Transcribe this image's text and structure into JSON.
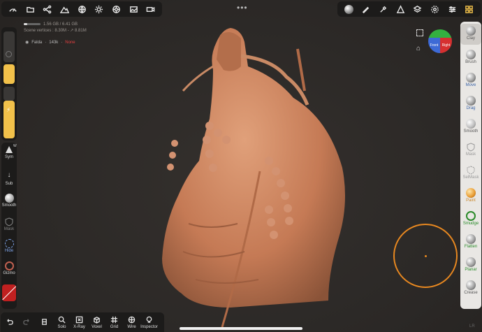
{
  "top_left_tools": [
    "dashboard-icon",
    "folder-icon",
    "scene-graph-icon",
    "mountain-icon",
    "globe-icon",
    "sun-icon",
    "gear-wheel-icon",
    "image-icon",
    "video-icon"
  ],
  "top_right_tools": [
    "matcap-icon",
    "brush-pen-icon",
    "eyedropper-icon",
    "triangle-icon",
    "layers-icon",
    "settings-icon",
    "sliders-icon",
    "grid-icon"
  ],
  "info": {
    "memory": "1.56 GB / 6.41 GB",
    "scene_vertices": "Scene vertices : 8.30M - ↗ 8.81M",
    "object_name": "Falda",
    "object_count": "143k",
    "object_tag": "None"
  },
  "left": {
    "sym_label": "Sym",
    "sym_flag": "W",
    "sub_label": "Sub",
    "smooth_label": "Smooth",
    "mask_label": "Mask",
    "hide_label": "Hide",
    "gizmo_label": "Gizmo"
  },
  "right": {
    "tools": [
      {
        "label": "Clay",
        "selected": true
      },
      {
        "label": "Brush"
      },
      {
        "label": "Move"
      },
      {
        "label": "Drag"
      },
      {
        "label": "Smooth"
      },
      {
        "label": "Mask"
      },
      {
        "label": "SelMask"
      },
      {
        "label": "Paint"
      },
      {
        "label": "Smudge"
      },
      {
        "label": "Flatten"
      },
      {
        "label": "Planar"
      },
      {
        "label": "Crease"
      }
    ]
  },
  "cube": {
    "front": "Front",
    "right": "Right"
  },
  "bottom": {
    "undo": "",
    "redo": "",
    "clip": "",
    "solo": "Solo",
    "xray": "X-Ray",
    "voxel": "Voxel",
    "grid": "Grid",
    "wire": "Wire",
    "inspector": "Inspector"
  },
  "corner_label": "LR",
  "colors": {
    "accent_yellow": "#f2c14a",
    "clay": "#c9805a",
    "ring": "#e88820"
  }
}
